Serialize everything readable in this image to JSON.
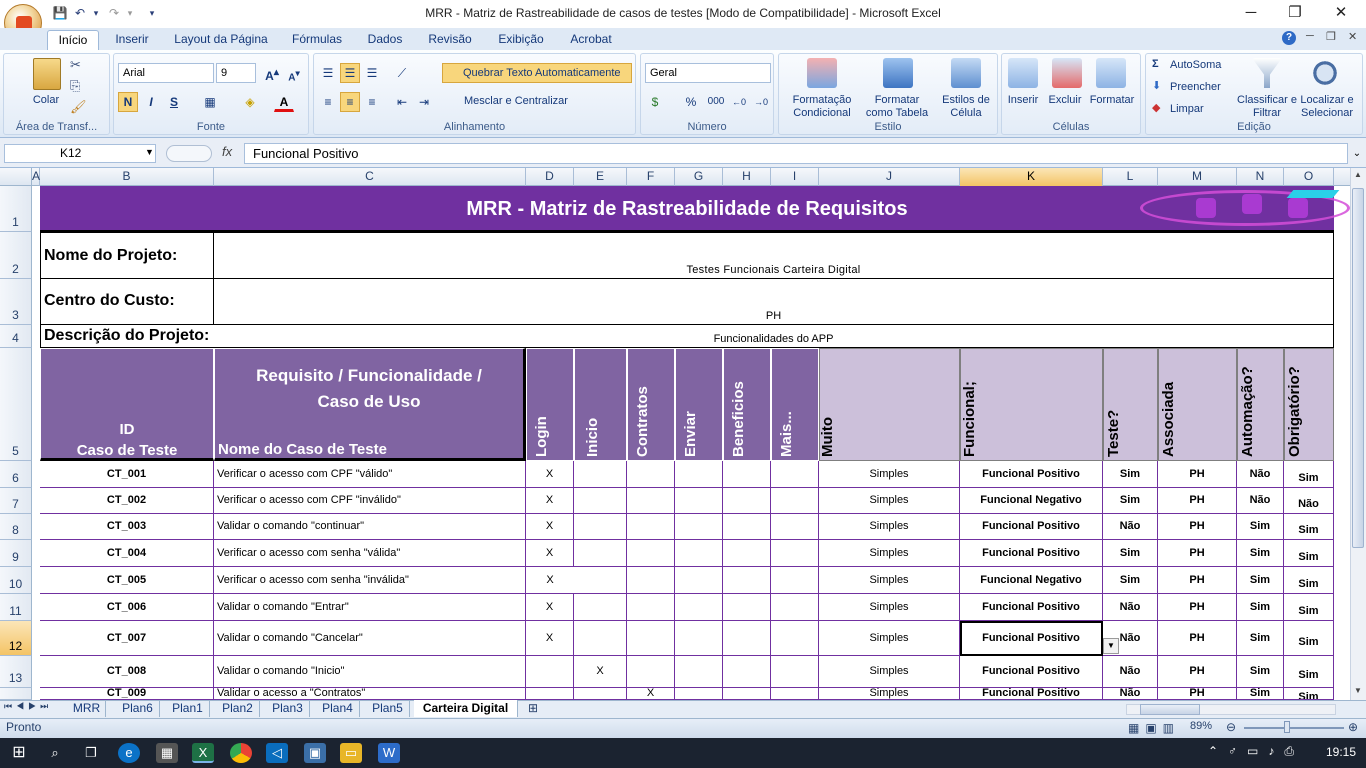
{
  "window": {
    "title": "MRR - Matriz de Rastreabilidade de casos de testes  [Modo de Compatibilidade] - Microsoft Excel",
    "minimize": "─",
    "restore": "❐",
    "close": "✕"
  },
  "ribbon_tabs": [
    "Início",
    "Inserir",
    "Layout da Página",
    "Fórmulas",
    "Dados",
    "Revisão",
    "Exibição",
    "Acrobat"
  ],
  "ribbon": {
    "clipboard": {
      "label": "Área de Transf...",
      "paste": "Colar"
    },
    "font": {
      "label": "Fonte",
      "name": "Arial",
      "size": "9",
      "bold": "N",
      "italic": "I",
      "underline": "S"
    },
    "alignment": {
      "label": "Alinhamento",
      "wrap": "Quebrar Texto Automaticamente",
      "merge": "Mesclar e Centralizar"
    },
    "number": {
      "label": "Número",
      "format": "Geral",
      "percent": "%",
      "thousands": "000"
    },
    "styles": {
      "label": "Estilo",
      "conditional": "Formatação Condicional",
      "table": "Formatar como Tabela",
      "cell_styles": "Estilos de Célula"
    },
    "cells": {
      "label": "Células",
      "insert": "Inserir",
      "delete": "Excluir",
      "format": "Formatar"
    },
    "editing": {
      "label": "Edição",
      "autosum": "AutoSoma",
      "fill": "Preencher",
      "clear": "Limpar",
      "sort": "Classificar e Filtrar",
      "find": "Localizar e Selecionar"
    }
  },
  "formula_bar": {
    "cell_ref": "K12",
    "fx": "fx",
    "value": "Funcional Positivo"
  },
  "columns": [
    "A",
    "B",
    "C",
    "D",
    "E",
    "F",
    "G",
    "H",
    "I",
    "J",
    "K",
    "L",
    "M",
    "N",
    "O"
  ],
  "rows": [
    "1",
    "2",
    "3",
    "4",
    "5",
    "6",
    "7",
    "8",
    "9",
    "10",
    "11",
    "12",
    "13"
  ],
  "sheet": {
    "title": "MRR - Matriz de Rastreabilidade de Requisitos",
    "project_name_label": "Nome do Projeto:",
    "project_name": "Testes Funcionais Carteira Digital",
    "cost_center_label": "Centro do Custo:",
    "cost_center": "PH",
    "description_label": "Descrição do Projeto:",
    "description": "Funcionalidades do APP",
    "header": {
      "id": "ID\nCaso de Teste",
      "requirement": "Requisito / Funcionalidade  /\nCaso de Uso",
      "test_name": "Nome do Caso de Teste",
      "login": "Login",
      "inicio": "Inicio",
      "contratos": "Contratos",
      "enviar": "Enviar",
      "beneficios": "Beneficios",
      "mais": "Mais...",
      "complexidade": "Complexidade (Muito Simples; Simples; Média; Complexo; Muito",
      "tipo": "Tipo Teste (Funcional Positivo; Funcional Negativo; Não Funcional;",
      "massa": "Necessidade de Massa de Teste?",
      "quem": "Quem solicitou (Sigla Associada",
      "automacao": "Passível de Automação?",
      "regressivo": "Regressivo Obrigatório?"
    },
    "test_rows": [
      {
        "id": "CT_001",
        "name": "Verificar o acesso com CPF \"válido\"",
        "login": "X",
        "inicio": "",
        "contratos": "",
        "complex": "Simples",
        "tipo": "Funcional Positivo",
        "massa": "Sim",
        "quem": "PH",
        "auto": "Não",
        "regr": "Sim"
      },
      {
        "id": "CT_002",
        "name": "Verificar o acesso com CPF \"inválido\"",
        "login": "X",
        "inicio": "",
        "contratos": "",
        "complex": "Simples",
        "tipo": "Funcional Negativo",
        "massa": "Sim",
        "quem": "PH",
        "auto": "Não",
        "regr": "Não"
      },
      {
        "id": "CT_003",
        "name": "Validar o comando \"continuar\"",
        "login": "X",
        "inicio": "",
        "contratos": "",
        "complex": "Simples",
        "tipo": "Funcional Positivo",
        "massa": "Não",
        "quem": "PH",
        "auto": "Sim",
        "regr": "Sim"
      },
      {
        "id": "CT_004",
        "name": "Verificar o acesso com senha \"válida\"",
        "login": "X",
        "inicio": "",
        "contratos": "",
        "complex": "Simples",
        "tipo": "Funcional Positivo",
        "massa": "Sim",
        "quem": "PH",
        "auto": "Sim",
        "regr": "Sim"
      },
      {
        "id": "CT_005",
        "name": "Verificar o acesso com senha \"inválida\"",
        "login": "X",
        "inicio": "",
        "contratos": "",
        "complex": "Simples",
        "tipo": "Funcional Negativo",
        "massa": "Sim",
        "quem": "PH",
        "auto": "Sim",
        "regr": "Sim"
      },
      {
        "id": "CT_006",
        "name": "Validar o comando \"Entrar\"",
        "login": "X",
        "inicio": "",
        "contratos": "",
        "complex": "Simples",
        "tipo": "Funcional Positivo",
        "massa": "Não",
        "quem": "PH",
        "auto": "Sim",
        "regr": "Sim"
      },
      {
        "id": "CT_007",
        "name": "Validar o comando \"Cancelar\"",
        "login": "X",
        "inicio": "",
        "contratos": "",
        "complex": "Simples",
        "tipo": "Funcional Positivo",
        "massa": "Não",
        "quem": "PH",
        "auto": "Sim",
        "regr": "Sim"
      },
      {
        "id": "CT_008",
        "name": "Validar o comando \"Inicio\"",
        "login": "",
        "inicio": "X",
        "contratos": "",
        "complex": "Simples",
        "tipo": "Funcional Positivo",
        "massa": "Não",
        "quem": "PH",
        "auto": "Sim",
        "regr": "Sim"
      },
      {
        "id": "CT_009",
        "name": "Validar o acesso a \"Contratos\"",
        "login": "",
        "inicio": "",
        "contratos": "X",
        "complex": "Simples",
        "tipo": "Funcional Positivo",
        "massa": "Não",
        "quem": "PH",
        "auto": "Sim",
        "regr": "Sim"
      }
    ]
  },
  "sheet_tabs": [
    "MRR",
    "Plan6",
    "Plan1",
    "Plan2",
    "Plan3",
    "Plan4",
    "Plan5",
    "Carteira Digital"
  ],
  "status": {
    "ready": "Pronto",
    "zoom": "89%"
  },
  "taskbar": {
    "time": "19:15"
  },
  "colors": {
    "title_band": "#7030a0",
    "header_dark": "#8064a2",
    "header_light": "#ccc0da",
    "ribbon_bg": "#dfe9f5"
  }
}
